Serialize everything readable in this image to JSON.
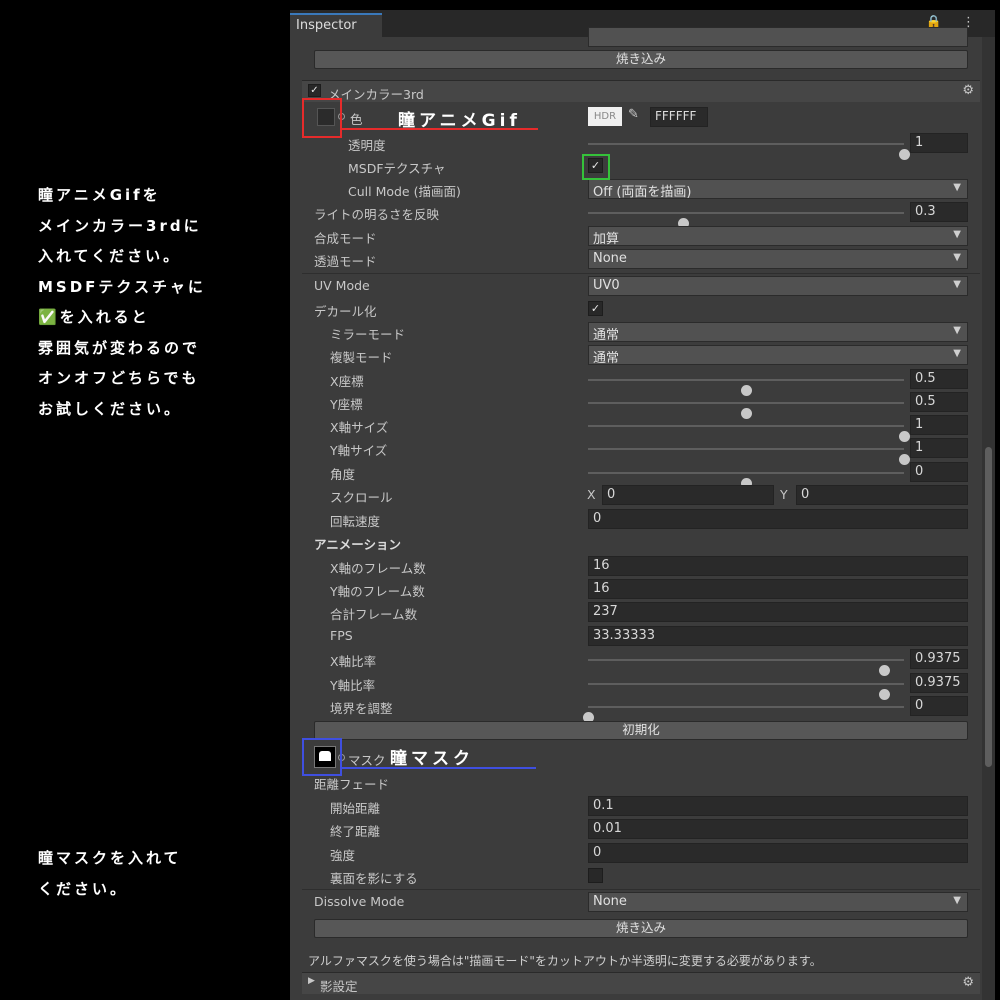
{
  "annotations": {
    "left_top": "瞳アニメGifを\nメインカラー3rdに\n入れてください。\nMSDFテクスチャに\n✅を入れると\n雰囲気が変わるので\nオンオフどちらでも\nお試しください。",
    "left_bottom": "瞳マスクを入れて\nください。",
    "callout_red": "瞳アニメGif",
    "callout_blue": "瞳マスク"
  },
  "inspector": {
    "tab": "Inspector",
    "tab_icons": "🔒 ⋮",
    "bake_button": "焼き込み",
    "section_main3": "メインカラー3rd",
    "color_label": "色",
    "hdr": "HDR",
    "hex": "FFFFFF",
    "rows": {
      "opacity": {
        "label": "透明度",
        "value": "1",
        "fraction": 1.0
      },
      "msdf": {
        "label": "MSDFテクスチャ",
        "checked": true
      },
      "cull": {
        "label": "Cull Mode (描画面)",
        "value": "Off (両面を描画)"
      },
      "light": {
        "label": "ライトの明るさを反映",
        "value": "0.3",
        "fraction": 0.3
      },
      "blend": {
        "label": "合成モード",
        "value": "加算"
      },
      "transparency": {
        "label": "透過モード",
        "value": "None"
      },
      "uvmode": {
        "label": "UV Mode",
        "value": "UV0"
      },
      "decal": {
        "label": "デカール化",
        "checked": true
      },
      "mirror": {
        "label": "ミラーモード",
        "value": "通常"
      },
      "copy": {
        "label": "複製モード",
        "value": "通常"
      },
      "xpos": {
        "label": "X座標",
        "value": "0.5",
        "fraction": 0.5
      },
      "ypos": {
        "label": "Y座標",
        "value": "0.5",
        "fraction": 0.5
      },
      "xsize": {
        "label": "X軸サイズ",
        "value": "1",
        "fraction": 1.0
      },
      "ysize": {
        "label": "Y軸サイズ",
        "value": "1",
        "fraction": 1.0
      },
      "angle": {
        "label": "角度",
        "value": "0",
        "fraction": 0.5
      },
      "scroll": {
        "label": "スクロール",
        "x_label": "X",
        "x": "0",
        "y_label": "Y",
        "y": "0"
      },
      "rotspeed": {
        "label": "回転速度",
        "value": "0"
      },
      "anim_header": {
        "label": "アニメーション"
      },
      "xframes": {
        "label": "X軸のフレーム数",
        "value": "16"
      },
      "yframes": {
        "label": "Y軸のフレーム数",
        "value": "16"
      },
      "totalframes": {
        "label": "合計フレーム数",
        "value": "237"
      },
      "fps": {
        "label": "FPS",
        "value": "33.33333"
      },
      "xratio": {
        "label": "X軸比率",
        "value": "0.9375",
        "fraction": 0.9375
      },
      "yratio": {
        "label": "Y軸比率",
        "value": "0.9375",
        "fraction": 0.9375
      },
      "border": {
        "label": "境界を調整",
        "value": "0",
        "fraction": 0.0
      }
    },
    "reset_button": "初期化",
    "mask_label": "マスク",
    "distance_fade": "距離フェード",
    "fade_rows": {
      "start": {
        "label": "開始距離",
        "value": "0.1"
      },
      "end": {
        "label": "終了距離",
        "value": "0.01"
      },
      "strength": {
        "label": "強度",
        "value": "0"
      },
      "backface": {
        "label": "裏面を影にする",
        "checked": false
      }
    },
    "dissolve": {
      "label": "Dissolve Mode",
      "value": "None"
    },
    "note": "アルファマスクを使う場合は\"描画モード\"をカットアウトか半透明に変更する必要があります。",
    "shadow_section": "影設定"
  }
}
